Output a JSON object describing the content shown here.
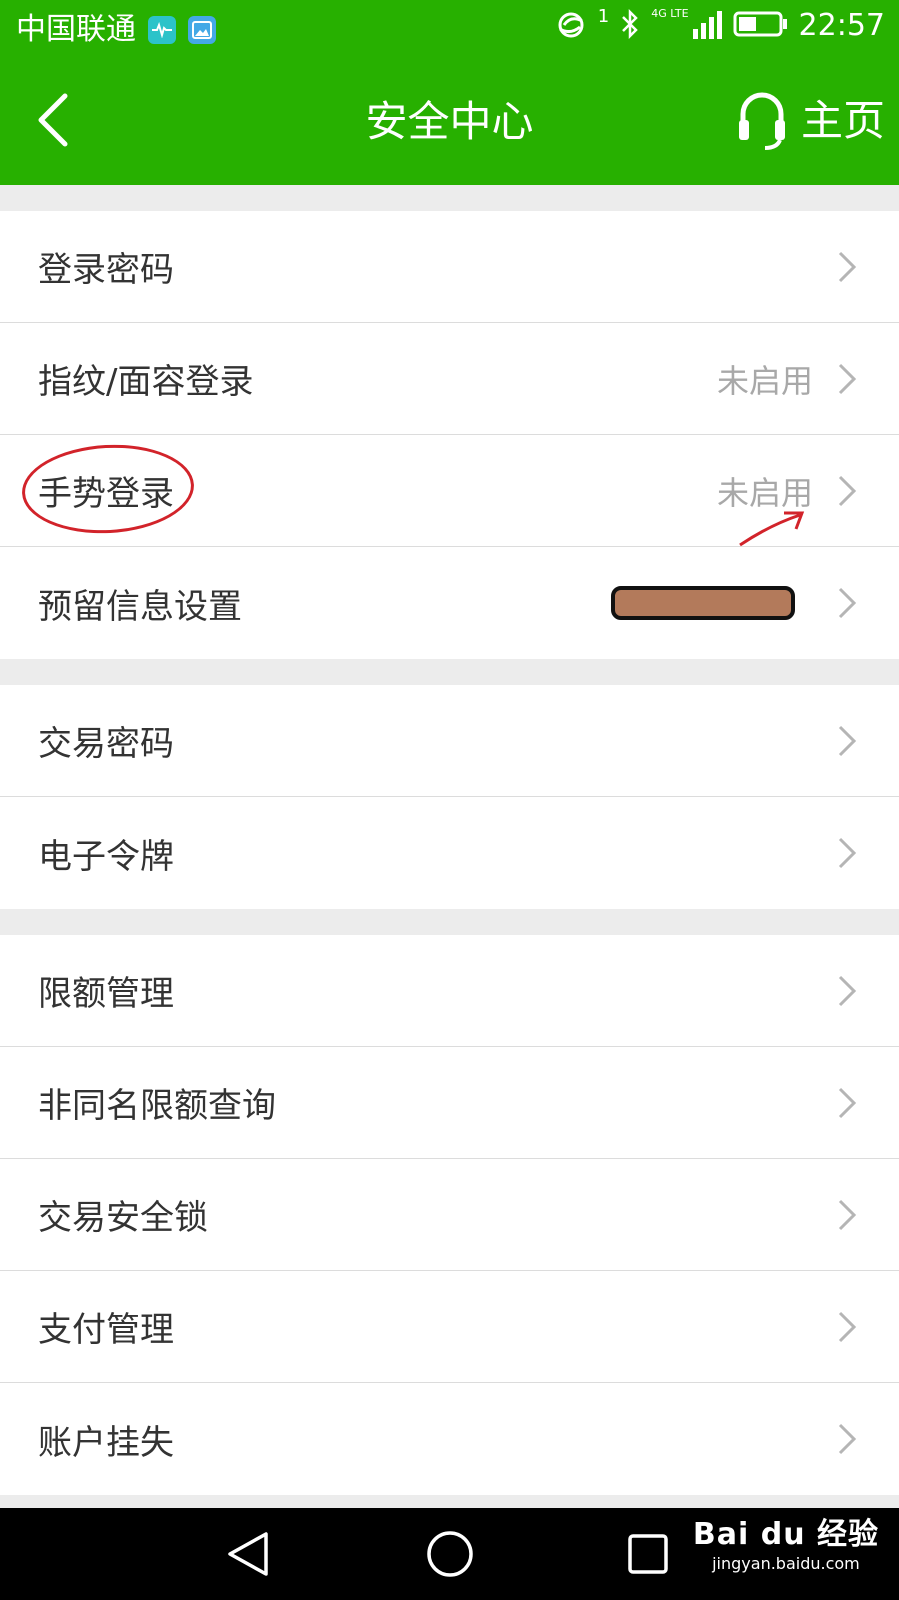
{
  "status_bar": {
    "carrier": "中国联通",
    "sim_slot": "1",
    "network_type": "4G LTE",
    "time": "22:57"
  },
  "app_bar": {
    "title": "安全中心",
    "home_label": "主页"
  },
  "groups": [
    {
      "items": [
        {
          "label": "登录密码",
          "value": ""
        },
        {
          "label": "指纹/面容登录",
          "value": "未启用"
        },
        {
          "label": "手势登录",
          "value": "未启用"
        },
        {
          "label": "预留信息设置",
          "value": ""
        }
      ]
    },
    {
      "items": [
        {
          "label": "交易密码",
          "value": ""
        },
        {
          "label": "电子令牌",
          "value": ""
        }
      ]
    },
    {
      "items": [
        {
          "label": "限额管理",
          "value": ""
        },
        {
          "label": "非同名限额查询",
          "value": ""
        },
        {
          "label": "交易安全锁",
          "value": ""
        },
        {
          "label": "支付管理",
          "value": ""
        },
        {
          "label": "账户挂失",
          "value": ""
        }
      ]
    }
  ],
  "watermark": {
    "brand": "Bai du 经验",
    "url": "jingyan.baidu.com"
  },
  "colors": {
    "header_green": "#27b000",
    "annotation_red": "#d2232a",
    "redaction_brown": "#b37a5b"
  },
  "icons": [
    "back-arrow-icon",
    "headset-icon",
    "chevron-right-icon",
    "nav-back-icon",
    "nav-home-icon",
    "nav-recents-icon"
  ]
}
